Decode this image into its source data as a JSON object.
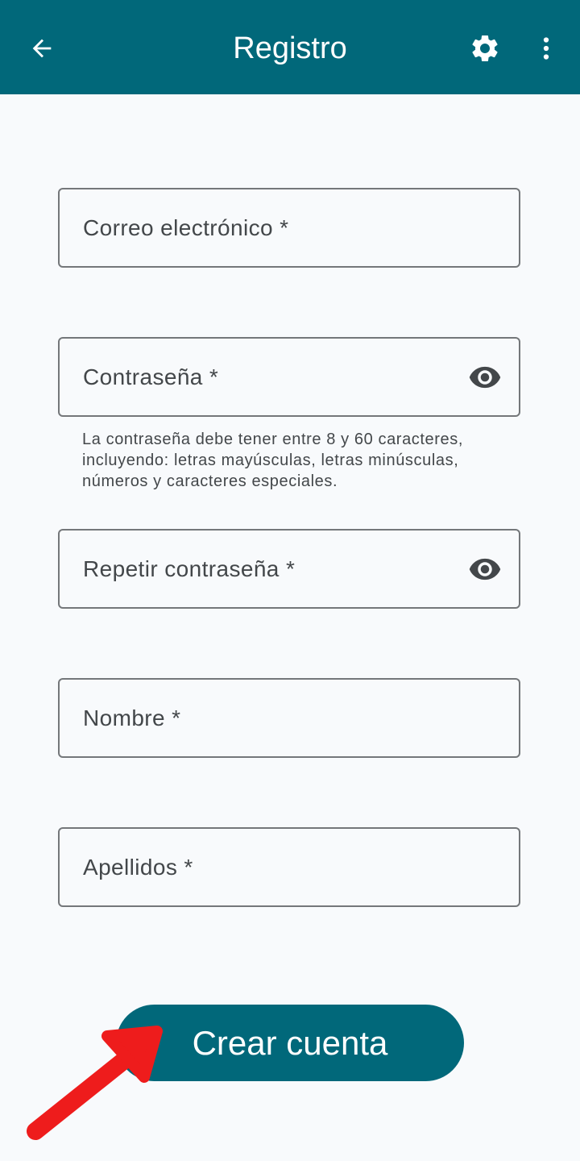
{
  "app_bar": {
    "title": "Registro",
    "back_icon": "arrow-left-icon",
    "settings_icon": "gear-icon",
    "more_icon": "more-vertical-icon",
    "color": "#01687a"
  },
  "form": {
    "email": {
      "label": "Correo electrónico *"
    },
    "password": {
      "label": "Contraseña *",
      "toggle_icon": "eye-icon",
      "helper": "La contraseña debe tener entre 8 y 60 caracteres, incluyendo: letras mayúsculas, letras minúsculas, números y caracteres especiales."
    },
    "repeat_password": {
      "label": "Repetir contraseña *",
      "toggle_icon": "eye-icon"
    },
    "first_name": {
      "label": "Nombre *"
    },
    "last_name": {
      "label": "Apellidos *"
    }
  },
  "create_button": {
    "label": "Crear cuenta"
  },
  "annotation": {
    "icon": "red-arrow-pointer",
    "color": "#ee1c1c"
  }
}
